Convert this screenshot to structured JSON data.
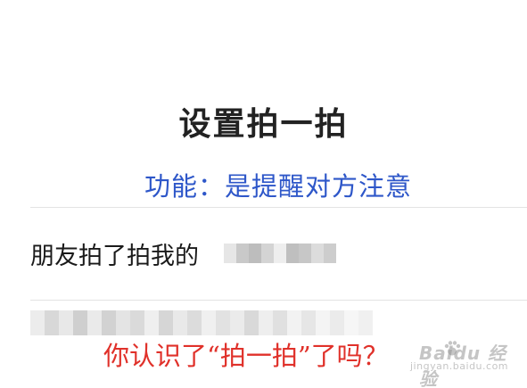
{
  "header": {
    "title": "设置拍一拍"
  },
  "annotations": {
    "function_note": "功能：是提醒对方注意",
    "question": "你认识了“拍一拍”了吗？"
  },
  "settings": {
    "pat_row_label": "朋友拍了拍我的"
  },
  "watermark": {
    "text": "Baidu 经验",
    "sub": "jingyan.baidu.com"
  }
}
